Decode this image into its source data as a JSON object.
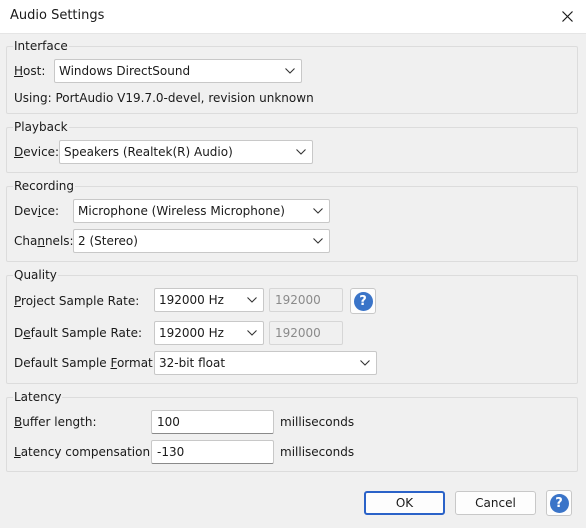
{
  "window": {
    "title": "Audio Settings"
  },
  "interface": {
    "legend": "Interface",
    "host_label": "Host:",
    "host_value": "Windows DirectSound",
    "using_text": "Using: PortAudio V19.7.0-devel, revision unknown"
  },
  "playback": {
    "legend": "Playback",
    "device_label": "Device:",
    "device_value": "Speakers (Realtek(R) Audio)"
  },
  "recording": {
    "legend": "Recording",
    "device_label": "Device:",
    "device_value": "Microphone (Wireless Microphone)",
    "channels_label": "Channels:",
    "channels_value": "2 (Stereo)"
  },
  "quality": {
    "legend": "Quality",
    "project_rate_label": "Project Sample Rate:",
    "project_rate_value": "192000 Hz",
    "project_rate_custom": "192000",
    "default_rate_label": "Default Sample Rate:",
    "default_rate_value": "192000 Hz",
    "default_rate_custom": "192000",
    "format_label": "Default Sample Format:",
    "format_value": "32-bit float"
  },
  "latency": {
    "legend": "Latency",
    "buffer_label": "Buffer length:",
    "buffer_value": "100",
    "buffer_unit": "milliseconds",
    "compensation_label": "Latency compensation:",
    "compensation_value": "-130",
    "compensation_unit": "milliseconds"
  },
  "buttons": {
    "ok": "OK",
    "cancel": "Cancel",
    "help": "?"
  },
  "colors": {
    "accent": "#2a62c8",
    "help_icon": "#3a74c8"
  },
  "icons": {
    "close": "close-icon",
    "dropdown": "chevron-down-icon",
    "help": "help-icon"
  }
}
